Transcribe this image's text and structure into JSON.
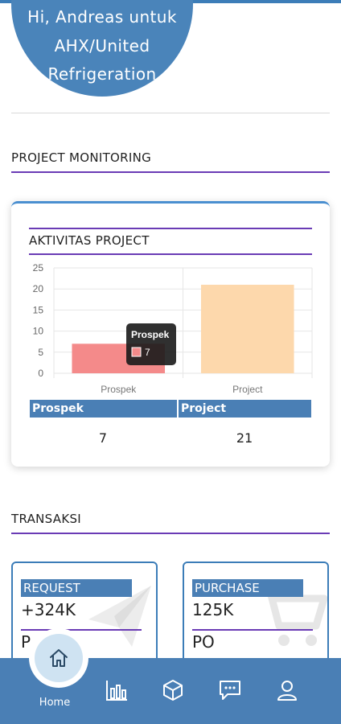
{
  "greeting": {
    "lines": [
      "Hi, Andreas untuk",
      "AHX/United",
      "Refrigeration"
    ]
  },
  "sections": {
    "project_monitoring": "PROJECT MONITORING",
    "transaksi": "TRANSAKSI"
  },
  "aktivitas_card": {
    "title": "AKTIVITAS PROJECT",
    "tooltip": {
      "label": "Prospek",
      "value": "7"
    },
    "stats": [
      {
        "label": "Prospek",
        "value": "7"
      },
      {
        "label": "Project",
        "value": "21"
      }
    ]
  },
  "chart_data": {
    "type": "bar",
    "categories": [
      "Prospek",
      "Project"
    ],
    "values": [
      7,
      21
    ],
    "colors": [
      "#f48a8a",
      "#fdd8ac"
    ],
    "yticks": [
      0,
      5,
      10,
      15,
      20,
      25
    ],
    "ylim": [
      0,
      25
    ],
    "grid": true,
    "title": "",
    "xlabel": "",
    "ylabel": ""
  },
  "transaksi": [
    {
      "label": "REQUEST",
      "value": "+324K",
      "sub": "P",
      "bg_icon": "paper-plane-icon"
    },
    {
      "label": "PURCHASE",
      "value": "125K",
      "sub": "PO",
      "bg_icon": "cart-icon"
    }
  ],
  "nav": {
    "home_label": "Home",
    "items": [
      "home-icon",
      "chart-icon",
      "box-icon",
      "chat-icon",
      "user-icon"
    ]
  },
  "colors": {
    "primary": "#4a7fb5",
    "accent_line": "#6a3bb5",
    "bar_prospek": "#f48a8a",
    "bar_project": "#fdd8ac"
  }
}
